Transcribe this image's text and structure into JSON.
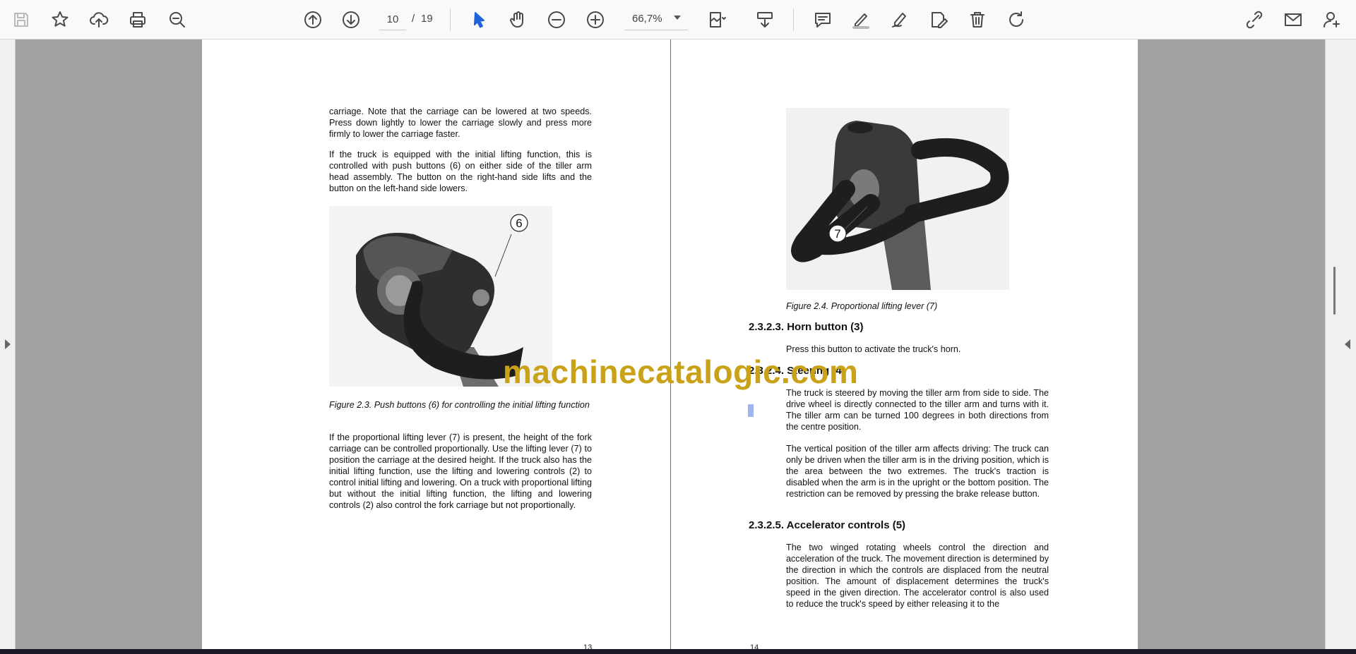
{
  "toolbar": {
    "page_current": "10",
    "page_separator": "/",
    "page_total": "19",
    "zoom": "66,7%",
    "icons": [
      "save-icon",
      "bookmark-star-icon",
      "upload-cloud-icon",
      "print-icon",
      "zoom-search-icon",
      "prev-page-icon",
      "next-page-icon",
      "select-cursor-icon",
      "hand-tool-icon",
      "zoom-out-icon",
      "zoom-in-icon",
      "page-fit-icon",
      "scroll-mode-icon",
      "comment-icon",
      "highlight-pen-icon",
      "draw-icon",
      "edit-sign-icon",
      "delete-icon",
      "rotate-icon",
      "share-link-icon",
      "email-icon",
      "add-user-icon"
    ]
  },
  "colors": {
    "accent": "#1f63d8",
    "watermark": "#c9a21a",
    "page_bg": "#ffffff",
    "viewer_bg": "#a1a1a1"
  },
  "left_page": {
    "para1": "carriage. Note that the carriage can be lowered at two speeds. Press down lightly to lower the carriage slowly and press more firmly to lower the carriage faster.",
    "para2": "If the truck is equipped with the initial lifting function, this is controlled with push buttons (6) on either side of the tiller arm head assembly. The button on the right-hand side lifts and the button on the left-hand side lowers.",
    "figure_label": "6",
    "figure_caption": "Figure 2.3. Push buttons (6) for controlling the initial lifting function",
    "para3": "If the proportional lifting lever (7) is present, the height of the fork carriage can be controlled proportionally. Use the lifting lever (7) to position the carriage at the desired height. If the truck also has the initial lifting function, use the lifting and lowering controls (2) to control initial lifting and lowering. On a truck with proportional lifting but without the initial lifting function, the lifting and lowering controls (2) also control the fork carriage but not proportionally.",
    "page_number": "13"
  },
  "right_page": {
    "figure_label": "7",
    "figure_caption": "Figure 2.4. Proportional lifting lever (7)",
    "h_horn": "2.3.2.3. Horn button (3)",
    "horn_text": "Press this button to activate the truck's horn.",
    "h_steering": "2.3.2.4. Steering (4)",
    "steering_p1": "The truck is steered by moving the tiller arm from side to side. The drive wheel is directly connected to the tiller arm and turns with it. The tiller arm can be turned 100 degrees in both directions from the centre position.",
    "steering_p2": "The vertical position of the tiller arm affects driving: The truck can only be driven when the tiller arm is in the driving position, which is the area between the two extremes. The truck's traction is disabled when the arm is in the upright or the bottom position. The restriction can be removed by pressing the brake release button.",
    "h_accel": "2.3.2.5. Accelerator controls (5)",
    "accel_p1": "The two winged rotating wheels control the direction and acceleration of the truck. The movement direction is determined by the direction in which the controls are displaced from the neutral position. The amount of displacement determines the truck's speed in the given direction. The accelerator control is also used to reduce the truck's speed by either releasing it to the",
    "page_number": "14"
  },
  "watermark": "machinecatalogic.com"
}
